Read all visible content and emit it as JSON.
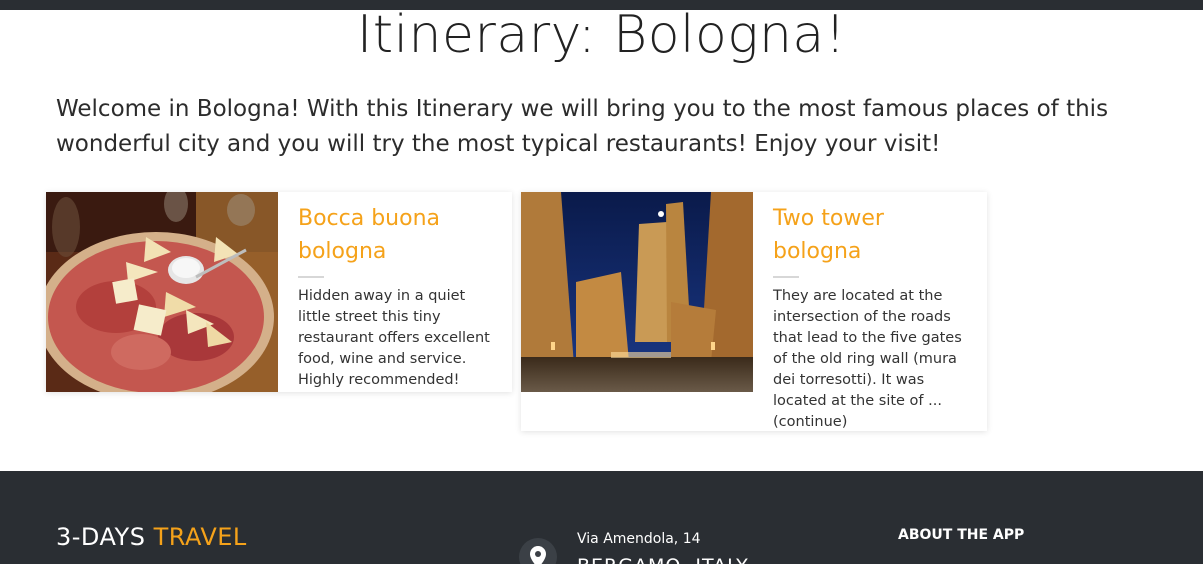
{
  "page": {
    "title": "Itinerary: Bologna!",
    "intro": "Welcome in Bologna! With this Itinerary we will bring you to the most famous places of this wonderful city and you will try the most typical restaurants! Enjoy your visit!"
  },
  "cards": [
    {
      "title": "Bocca buona bologna",
      "text": "Hidden away in a quiet little street this tiny restaurant offers excellent food, wine and service. Highly recommended!",
      "image": "charcuterie-platter"
    },
    {
      "title": "Two tower bologna",
      "text": "They are located at the intersection of the roads that lead to the five gates of the old ring wall (mura dei torresotti). It was located at the site of ... (continue)",
      "image": "two-towers-night"
    }
  ],
  "footer": {
    "brand_main": "3-DAYS",
    "brand_accent": "TRAVEL",
    "address_line1": "Via Amendola, 14",
    "address_line2": "BERGAMO, ITALY",
    "about_heading": "ABOUT THE APP",
    "location_icon": "map-pin-icon"
  },
  "colors": {
    "accent": "#f5a21a",
    "footer_bg": "#2a2e33",
    "topbar_bg": "#2a2e33"
  }
}
